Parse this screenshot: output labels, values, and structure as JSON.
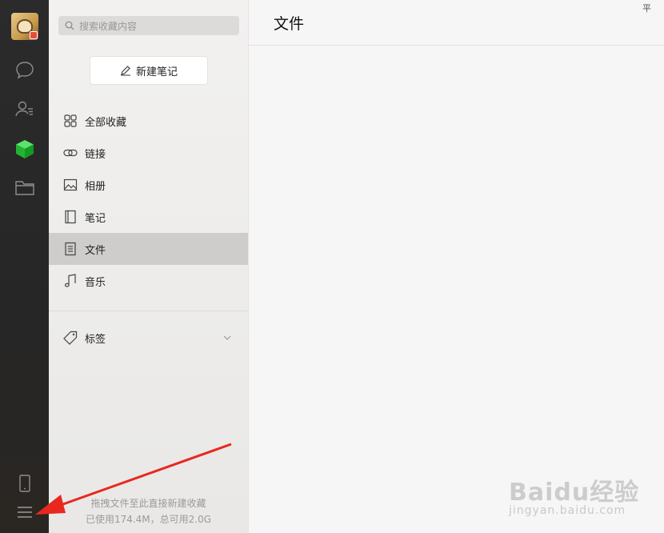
{
  "search": {
    "placeholder": "搜索收藏内容"
  },
  "new_note": {
    "label": "新建笔记"
  },
  "nav": [
    {
      "label": "全部收藏",
      "icon": "grid-icon"
    },
    {
      "label": "链接",
      "icon": "link-icon"
    },
    {
      "label": "相册",
      "icon": "image-icon"
    },
    {
      "label": "笔记",
      "icon": "notebook-icon"
    },
    {
      "label": "文件",
      "icon": "file-icon",
      "active": true
    },
    {
      "label": "音乐",
      "icon": "music-note-icon"
    }
  ],
  "tags": {
    "label": "标签"
  },
  "footer": {
    "hint": "拖拽文件至此直接新建收藏",
    "usage": "已使用174.4M，总可用2.0G"
  },
  "main": {
    "title": "文件",
    "pin_glyph": "平"
  },
  "watermark": {
    "brand": "Baidu经验",
    "url": "jingyan.baidu.com"
  },
  "colors": {
    "accent_green": "#2bbb3c",
    "annotation_red": "#e8281e",
    "active_row": "#cfcdcc"
  }
}
